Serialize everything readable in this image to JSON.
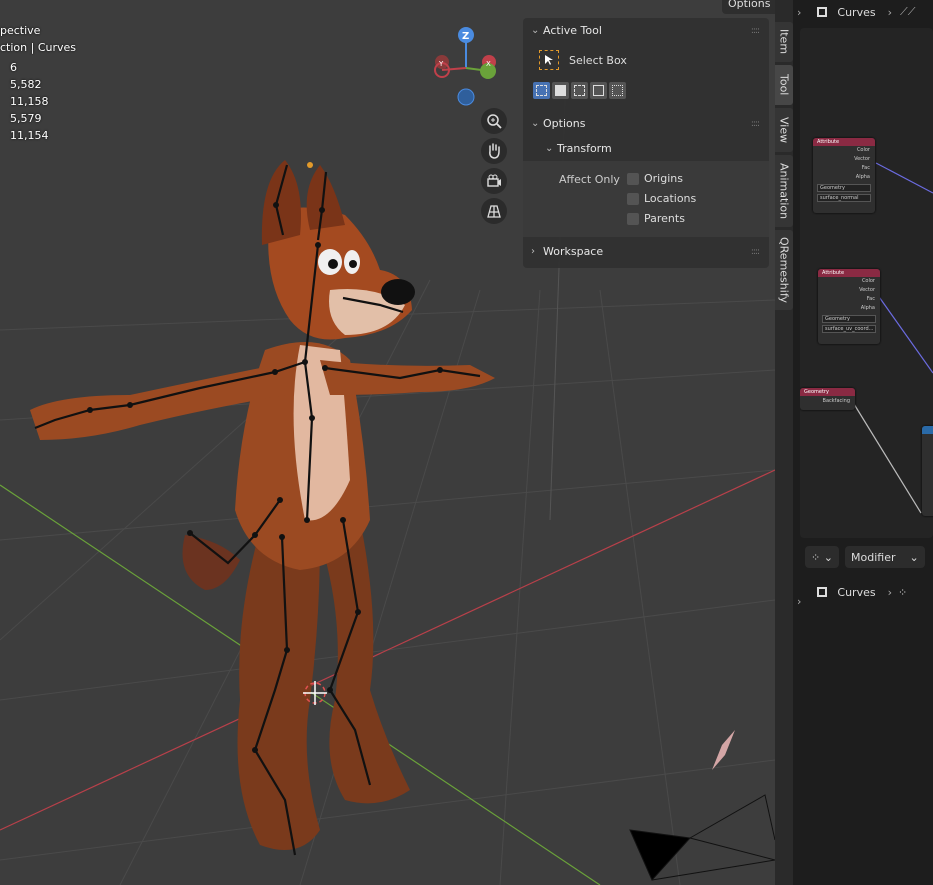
{
  "viewport": {
    "header_lines": [
      "pective",
      "ction | Curves"
    ],
    "stats": [
      {
        "value": "6"
      },
      {
        "value": "5,582"
      },
      {
        "value": "11,158"
      },
      {
        "value": "5,579"
      },
      {
        "value": "11,154"
      }
    ],
    "options_label": "Options",
    "gizmo": {
      "z": "Z",
      "y": "Y",
      "x": "X"
    }
  },
  "npanel": {
    "active_tool_title": "Active Tool",
    "tool_name": "Select Box",
    "options_title": "Options",
    "transform_title": "Transform",
    "affect_only_label": "Affect Only",
    "checkboxes": [
      "Origins",
      "Locations",
      "Parents"
    ],
    "workspace_title": "Workspace"
  },
  "tabs": [
    "Item",
    "Tool",
    "View",
    "Animation",
    "QRemeshify"
  ],
  "right": {
    "top_title": "Curves",
    "modifier_label": "Modifier",
    "bottom_title": "Curves",
    "nodes": {
      "attr1": {
        "title": "Attribute",
        "outputs": [
          "Color",
          "Vector",
          "Fac",
          "Alpha"
        ],
        "domain": "Geometry",
        "name": "surface_normal"
      },
      "attr2": {
        "title": "Attribute",
        "outputs": [
          "Color",
          "Vector",
          "Fac",
          "Alpha"
        ],
        "domain": "Geometry",
        "name": "surface_uv_coord..."
      },
      "geom": {
        "title": "Geometry",
        "output": "Backfacing"
      }
    }
  },
  "colors": {
    "accent_blue": "#4772b3",
    "node_header": "#8a2a43",
    "axis_red": "#c0404a",
    "axis_green": "#6aa23a"
  }
}
